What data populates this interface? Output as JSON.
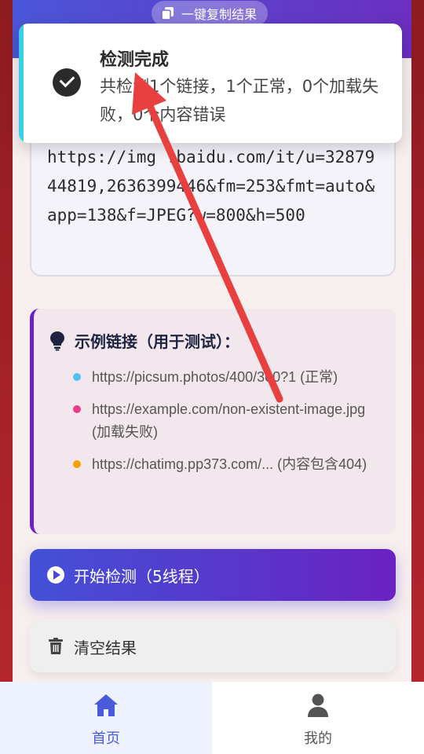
{
  "header": {
    "copy_button": "一键复制结果"
  },
  "url_input": {
    "value": "https://img .baidu.com/it/u=3287944819,2636399446&fm=253&fmt=auto&app=138&f=JPEG?w=800&h=500"
  },
  "examples": {
    "title": "示例链接（用于测试）：",
    "items": [
      {
        "text": "https://picsum.photos/400/300?1 (正常)",
        "color": "#4cc3f0"
      },
      {
        "text": "https://example.com/non-existent-image.jpg (加载失败)",
        "color": "#ee3a8c"
      },
      {
        "text": "https://chatimg.pp373.com/... (内容包含404)",
        "color": "#f59f00"
      }
    ]
  },
  "actions": {
    "start_label": "开始检测（5线程）",
    "clear_label": "清空结果"
  },
  "toast": {
    "title": "检测完成",
    "message": "共检测1个链接，1个正常，0个加载失败，0个内容错误"
  },
  "tabbar": {
    "home_label": "首页",
    "mine_label": "我的"
  },
  "colors": {
    "accent": "#4a5adb",
    "header_start": "#4a56d8",
    "header_end": "#6b2fc0",
    "arrow": "#e8403e",
    "toast_bar": "#3ad0e8"
  }
}
